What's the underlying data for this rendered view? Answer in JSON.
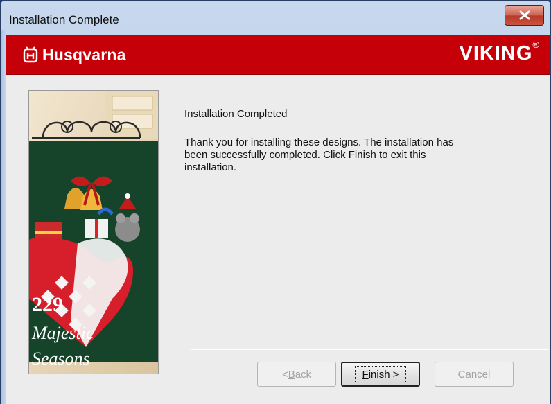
{
  "window": {
    "title": "Installation Complete",
    "close_icon": "close-icon"
  },
  "banner": {
    "left_brand": "Husqvarna",
    "right_brand": "VIKING",
    "registered_mark": "®",
    "brand_color": "#c60008"
  },
  "sidebar_image": {
    "number": "229",
    "caption_line1": "Majestic",
    "caption_line2": "Seasons"
  },
  "content": {
    "heading": "Installation Completed",
    "body": "Thank you for installing these designs. The installation has been successfully completed. Click Finish to exit this installation."
  },
  "buttons": {
    "back": {
      "prefix": "< ",
      "accel": "B",
      "rest": "ack",
      "enabled": false
    },
    "finish": {
      "accel": "F",
      "rest": "inish >",
      "enabled": true
    },
    "cancel": {
      "label": "Cancel",
      "enabled": false
    }
  }
}
